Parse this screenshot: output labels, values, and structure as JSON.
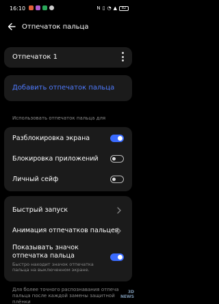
{
  "status_bar": {
    "time": "16:10",
    "battery": "82"
  },
  "header": {
    "title": "Отпечаток пальца"
  },
  "fingerprints": [
    {
      "label": "Отпечаток 1"
    }
  ],
  "add_fingerprint": {
    "label": "Добавить отпечаток пальца"
  },
  "usage_section": {
    "label": "Использовать отпечаток пальца для",
    "items": [
      {
        "label": "Разблокировка экрана",
        "enabled": true
      },
      {
        "label": "Блокировка приложений",
        "enabled": false
      },
      {
        "label": "Личный сейф",
        "enabled": false
      }
    ]
  },
  "settings": {
    "quick_launch": "Быстрый запуск",
    "animation": "Анимация отпечатков пальцев",
    "show_icon": {
      "label": "Показывать значок отпечатка пальца",
      "label_line1": "Показывать значок",
      "label_line2": "отпечатка пальца",
      "description": "Быстро находит значок отпечатка пальца на выключенном экране.",
      "description_line1": "Быстро находит значок отпечатка",
      "description_line2": "пальца на выключенном экране.",
      "enabled": true
    }
  },
  "footer": {
    "text_line1": "Для более точного распознавания отпеча",
    "text_line2": "пальца после каждой замены защитной плёнки"
  },
  "watermark": {
    "line1": "3D",
    "line2": "NEWS"
  },
  "colors": {
    "accent": "#3a6bff",
    "link": "#4f7bff",
    "card_bg": "#1b1b1b",
    "background": "#000000"
  }
}
